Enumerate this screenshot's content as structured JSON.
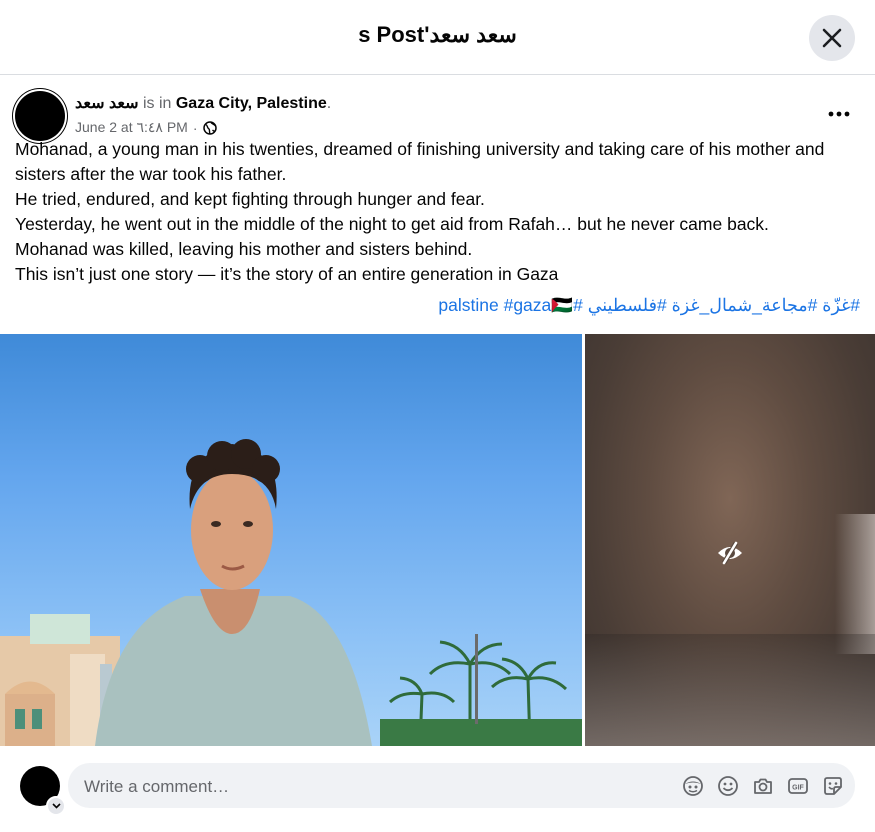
{
  "header": {
    "title": "سعد سعد's Post"
  },
  "post": {
    "author": "سعد سعد",
    "is_in_text": "is in",
    "location": "Gaza City, Palestine",
    "period": ".",
    "timestamp": "June 2 at ٦:٤٨ PM",
    "separator": "·",
    "privacy_icon": "globe-icon",
    "lines": [
      "Mohanad, a young man in his twenties, dreamed of finishing university and taking care of his mother and sisters after the war took his father.",
      "He tried, endured, and kept fighting through hunger and fear.",
      "Yesterday, he went out in the middle of the night to get aid from Rafah… but he never came back.",
      "Mohanad was killed, leaving his mother and sisters behind.",
      "This isn’t just one story — it’s the story of an entire generation in Gaza"
    ],
    "hashtags": [
      "#غزّة",
      "#مجاعة_شمال_غزة",
      "#فلسطيني",
      "#palstine",
      "#gaza"
    ],
    "flag_emoji": "🇵🇸"
  },
  "photos": {
    "left_subject": "young-man-photo",
    "right_state": "hidden-content",
    "right_icon": "eye-slash-icon"
  },
  "comment": {
    "placeholder": "Write a comment…",
    "icons": [
      "avatar-sticker-icon",
      "emoji-icon",
      "camera-icon",
      "gif-icon",
      "sticker-icon"
    ]
  },
  "colors": {
    "link": "#1b74e4",
    "muted": "#65676b",
    "input_bg": "#f0f2f5",
    "button_bg": "#e4e6eb"
  }
}
